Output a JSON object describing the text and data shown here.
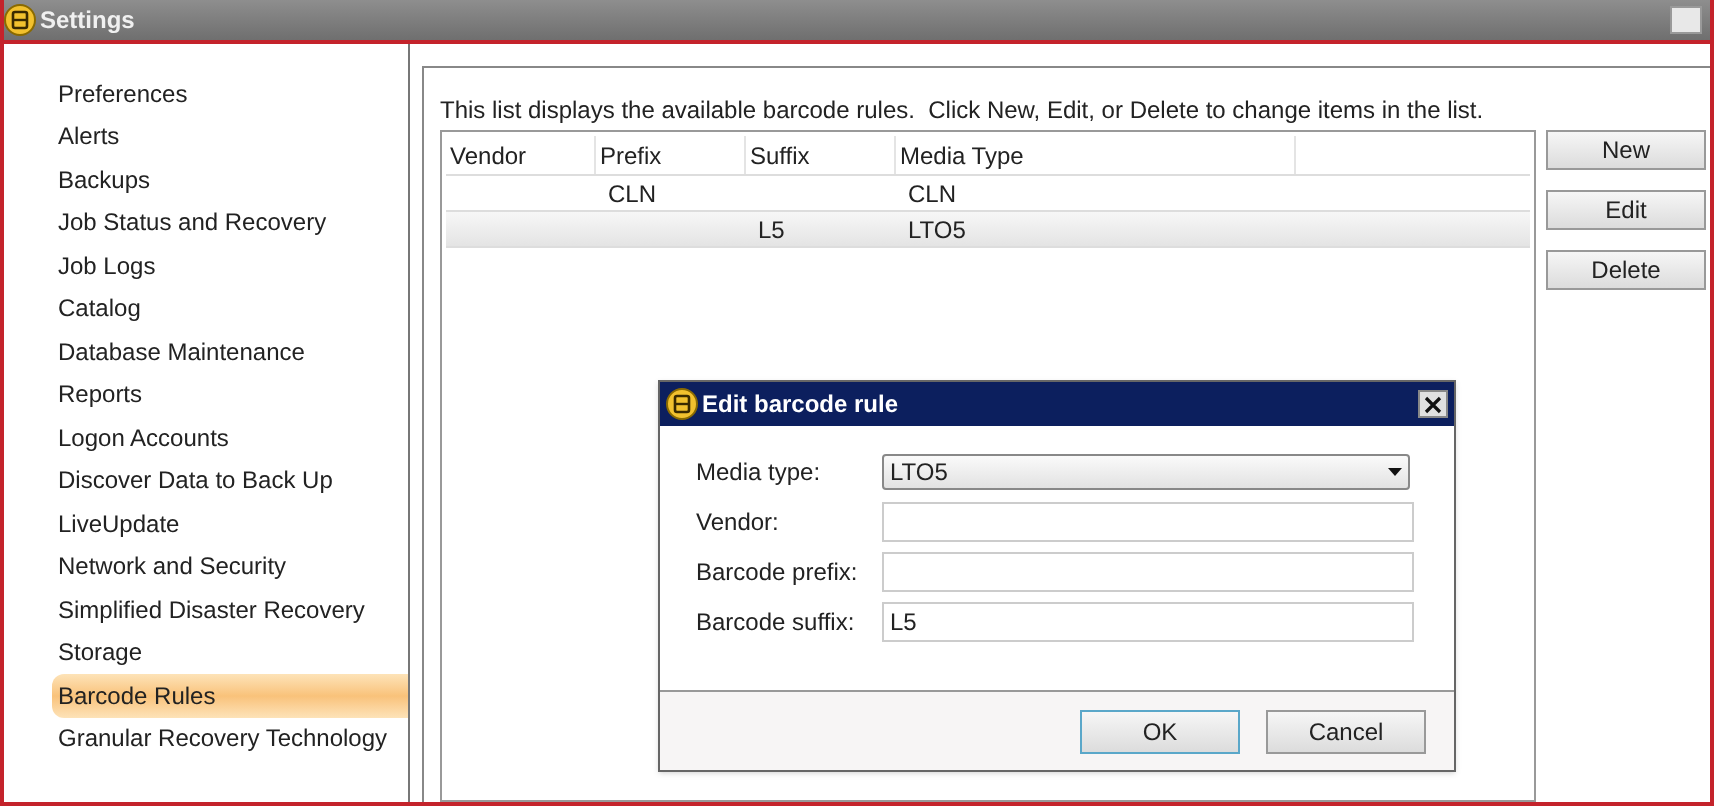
{
  "window": {
    "title": "Settings"
  },
  "sidebar": {
    "items": [
      {
        "label": "Preferences",
        "selected": false
      },
      {
        "label": "Alerts",
        "selected": false
      },
      {
        "label": "Backups",
        "selected": false
      },
      {
        "label": "Job Status and Recovery",
        "selected": false
      },
      {
        "label": "Job Logs",
        "selected": false
      },
      {
        "label": "Catalog",
        "selected": false
      },
      {
        "label": "Database Maintenance",
        "selected": false
      },
      {
        "label": "Reports",
        "selected": false
      },
      {
        "label": "Logon Accounts",
        "selected": false
      },
      {
        "label": "Discover Data to Back Up",
        "selected": false
      },
      {
        "label": "LiveUpdate",
        "selected": false
      },
      {
        "label": "Network and Security",
        "selected": false
      },
      {
        "label": "Simplified Disaster Recovery",
        "selected": false
      },
      {
        "label": "Storage",
        "selected": false
      },
      {
        "label": "Barcode Rules",
        "selected": true
      },
      {
        "label": "Granular Recovery Technology",
        "selected": false
      }
    ]
  },
  "description": "This list displays the available barcode rules.  Click New, Edit, or Delete to change items in the list.",
  "table": {
    "columns": [
      "Vendor",
      "Prefix",
      "Suffix",
      "Media Type"
    ],
    "rows": [
      {
        "cells": [
          null,
          "CLN",
          null,
          "CLN"
        ],
        "selected": false
      },
      {
        "cells": [
          null,
          null,
          "L5",
          "LTO5"
        ],
        "selected": true
      }
    ]
  },
  "buttons": [
    "New",
    "Edit",
    "Delete"
  ],
  "dialog": {
    "title": "Edit barcode rule",
    "fields": [
      {
        "kind": "dropdown",
        "label": "Media type:",
        "value": "LTO5"
      },
      {
        "kind": "text",
        "label": "Vendor:"
      },
      {
        "kind": "text",
        "label": "Barcode prefix:"
      },
      {
        "kind": "text",
        "label": "Barcode suffix:",
        "value": "L5"
      }
    ],
    "buttons": [
      {
        "label": "OK",
        "default": true
      },
      {
        "label": "Cancel",
        "default": false
      }
    ]
  }
}
